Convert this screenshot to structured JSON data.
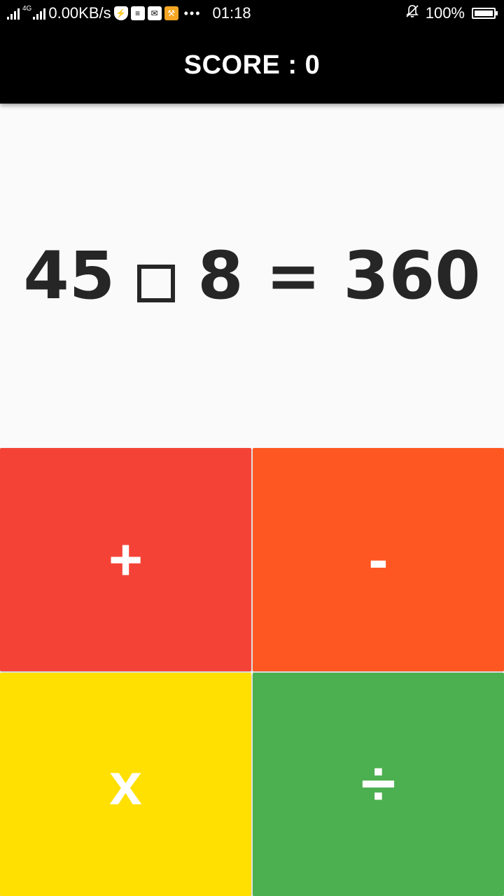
{
  "status_bar": {
    "network_label": "4G",
    "speed": "0.00KB/s",
    "dots": "•••",
    "time": "01:18",
    "battery": "100%"
  },
  "header": {
    "score_label": "SCORE : 0"
  },
  "equation": {
    "left_operand": "45",
    "right_operand": "8",
    "equals": "=",
    "result": "360"
  },
  "buttons": {
    "plus": "+",
    "minus": "-",
    "times": "x",
    "divide": "÷"
  },
  "colors": {
    "plus": "#f44336",
    "minus": "#ff5722",
    "times": "#ffe000",
    "divide": "#4caf50",
    "header_bg": "#000000",
    "background": "#fafafa"
  },
  "icons": [
    "signal-icon",
    "shield-icon",
    "document-icon",
    "mail-icon",
    "tool-icon",
    "mute-bell-icon",
    "battery-icon"
  ]
}
